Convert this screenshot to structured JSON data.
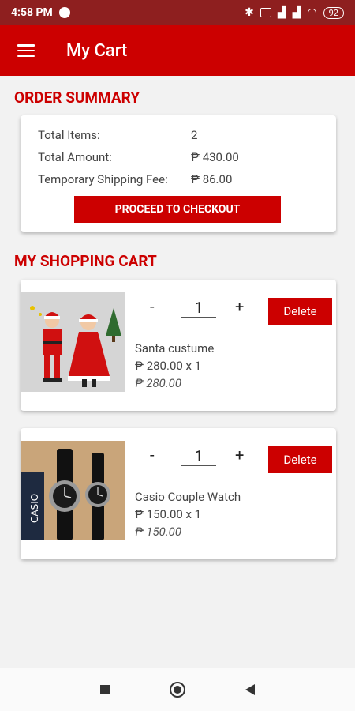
{
  "status": {
    "time": "4:58 PM",
    "battery": "92"
  },
  "app": {
    "title": "My Cart"
  },
  "summary": {
    "heading": "ORDER SUMMARY",
    "rows": [
      {
        "label": "Total Items:",
        "value": "2"
      },
      {
        "label": "Total Amount:",
        "value": "₱ 430.00"
      },
      {
        "label": "Temporary Shipping Fee:",
        "value": "₱ 86.00"
      }
    ],
    "checkout_label": "PROCEED TO CHECKOUT"
  },
  "cart": {
    "heading": "MY SHOPPING CART",
    "items": [
      {
        "name": "Santa custume",
        "price_line": "₱ 280.00 x 1",
        "total": "₱ 280.00",
        "qty": "1",
        "minus": "-",
        "plus": "+",
        "delete_label": "Delete"
      },
      {
        "name": "Casio Couple Watch",
        "price_line": "₱ 150.00 x 1",
        "total": "₱ 150.00",
        "qty": "1",
        "minus": "-",
        "plus": "+",
        "delete_label": "Delete"
      }
    ]
  },
  "colors": {
    "primary": "#cc0000",
    "statusbar": "#8e1f1f",
    "background": "#f2f2f2"
  }
}
